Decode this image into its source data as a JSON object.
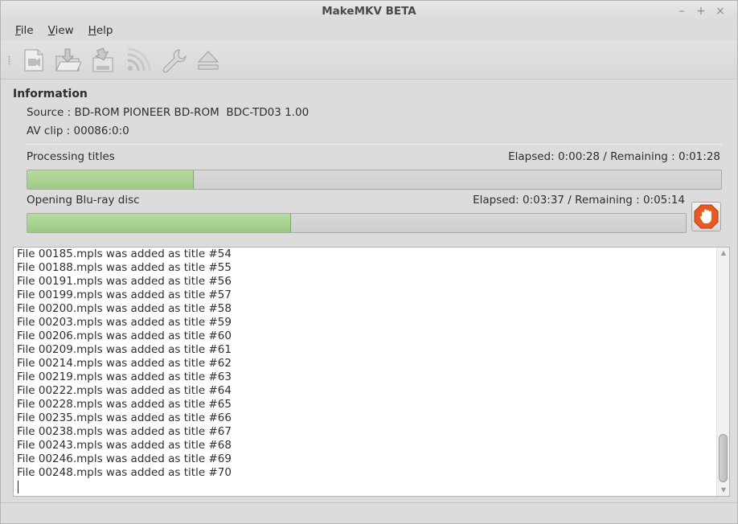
{
  "window": {
    "title": "MakeMKV BETA"
  },
  "window_controls": {
    "minimize": "–",
    "maximize": "+",
    "close": "×"
  },
  "menu": [
    {
      "label": "File",
      "accel": "F",
      "rest": "ile"
    },
    {
      "label": "View",
      "accel": "V",
      "rest": "iew"
    },
    {
      "label": "Help",
      "accel": "H",
      "rest": "elp"
    }
  ],
  "toolbar": {
    "icons": [
      "open-files-icon",
      "open-disc-icon",
      "backup-icon",
      "stream-icon",
      "preferences-icon",
      "eject-icon"
    ]
  },
  "info": {
    "title": "Information",
    "source_label": "Source : ",
    "source_value": "BD-ROM PIONEER BD-ROM  BDC-TD03 1.00",
    "avclip_label": "AV clip : ",
    "avclip_value": "00086:0:0"
  },
  "progress1": {
    "label": "Processing titles",
    "time": "Elapsed: 0:00:28 / Remaining : 0:01:28",
    "fraction": 0.24
  },
  "progress2": {
    "label": "Opening Blu-ray disc",
    "time": "Elapsed: 0:03:37 / Remaining : 0:05:14",
    "fraction": 0.4
  },
  "colors": {
    "progress_fill": "#a9d392",
    "stop_button": "#e85a21"
  },
  "log": [
    "File 00185.mpls was added as title #54",
    "File 00188.mpls was added as title #55",
    "File 00191.mpls was added as title #56",
    "File 00199.mpls was added as title #57",
    "File 00200.mpls was added as title #58",
    "File 00203.mpls was added as title #59",
    "File 00206.mpls was added as title #60",
    "File 00209.mpls was added as title #61",
    "File 00214.mpls was added as title #62",
    "File 00219.mpls was added as title #63",
    "File 00222.mpls was added as title #64",
    "File 00228.mpls was added as title #65",
    "File 00235.mpls was added as title #66",
    "File 00238.mpls was added as title #67",
    "File 00243.mpls was added as title #68",
    "File 00246.mpls was added as title #69",
    "File 00248.mpls was added as title #70"
  ]
}
